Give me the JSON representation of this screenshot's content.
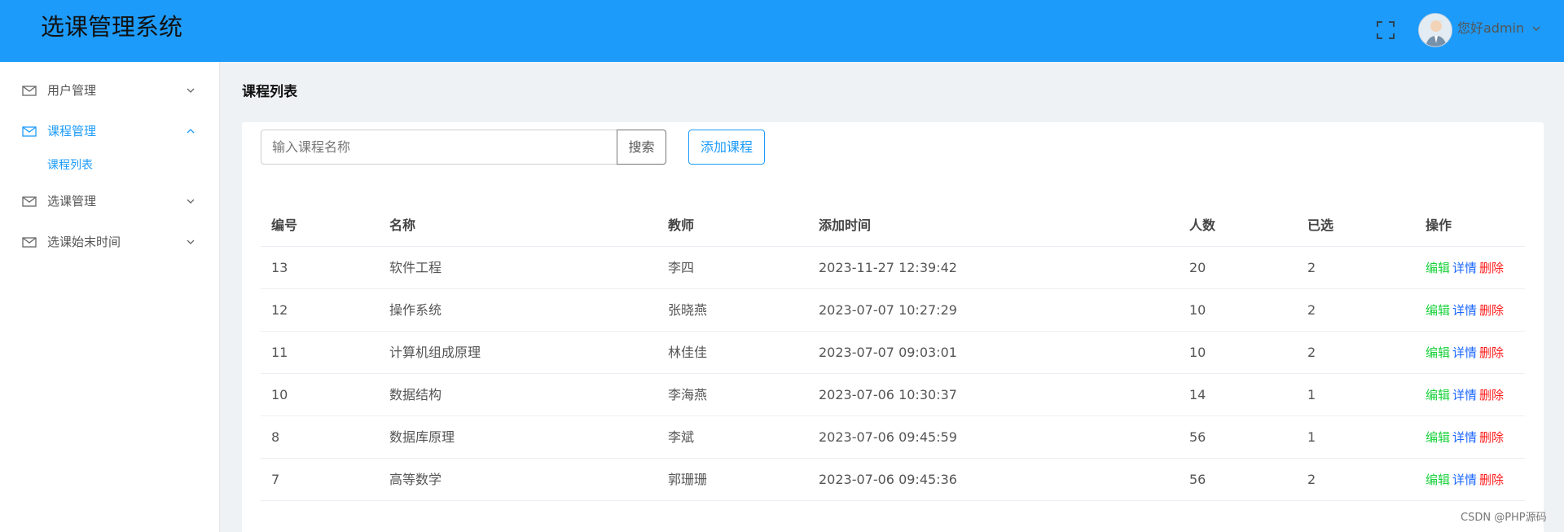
{
  "header": {
    "app_title": "选课管理系统",
    "user_greeting": "您好admin",
    "accent_color": "#1d9bfa",
    "icons": [
      "fullscreen-icon",
      "avatar",
      "chevron-down-icon"
    ]
  },
  "sidebar": {
    "items": [
      {
        "label": "用户管理",
        "icon": "mail-icon",
        "expanded": false
      },
      {
        "label": "课程管理",
        "icon": "mail-icon",
        "expanded": true,
        "active": true,
        "children": [
          {
            "label": "课程列表",
            "active": true
          }
        ]
      },
      {
        "label": "选课管理",
        "icon": "mail-icon",
        "expanded": false
      },
      {
        "label": "选课始末时间",
        "icon": "mail-icon",
        "expanded": false
      }
    ]
  },
  "main": {
    "page_title": "课程列表",
    "search": {
      "placeholder": "输入课程名称",
      "value": "",
      "button_label": "搜索"
    },
    "add_button_label": "添加课程",
    "table": {
      "columns": [
        "编号",
        "名称",
        "教师",
        "添加时间",
        "人数",
        "已选",
        "操作"
      ],
      "rows": [
        {
          "id": "13",
          "name": "软件工程",
          "teacher": "李四",
          "added": "2023-11-27 12:39:42",
          "capacity": "20",
          "selected": "2"
        },
        {
          "id": "12",
          "name": "操作系统",
          "teacher": "张晓燕",
          "added": "2023-07-07 10:27:29",
          "capacity": "10",
          "selected": "2"
        },
        {
          "id": "11",
          "name": "计算机组成原理",
          "teacher": "林佳佳",
          "added": "2023-07-07 09:03:01",
          "capacity": "10",
          "selected": "2"
        },
        {
          "id": "10",
          "name": "数据结构",
          "teacher": "李海燕",
          "added": "2023-07-06 10:30:37",
          "capacity": "14",
          "selected": "1"
        },
        {
          "id": "8",
          "name": "数据库原理",
          "teacher": "李斌",
          "added": "2023-07-06 09:45:59",
          "capacity": "56",
          "selected": "1"
        },
        {
          "id": "7",
          "name": "高等数学",
          "teacher": "郭珊珊",
          "added": "2023-07-06 09:45:36",
          "capacity": "56",
          "selected": "2"
        }
      ],
      "actions": {
        "edit": "编辑",
        "detail": "详情",
        "delete": "删除"
      },
      "action_colors": {
        "edit": "#19d13b",
        "detail": "#1a66ff",
        "delete": "#ff1a1a"
      }
    }
  },
  "watermark": "CSDN @PHP源码"
}
